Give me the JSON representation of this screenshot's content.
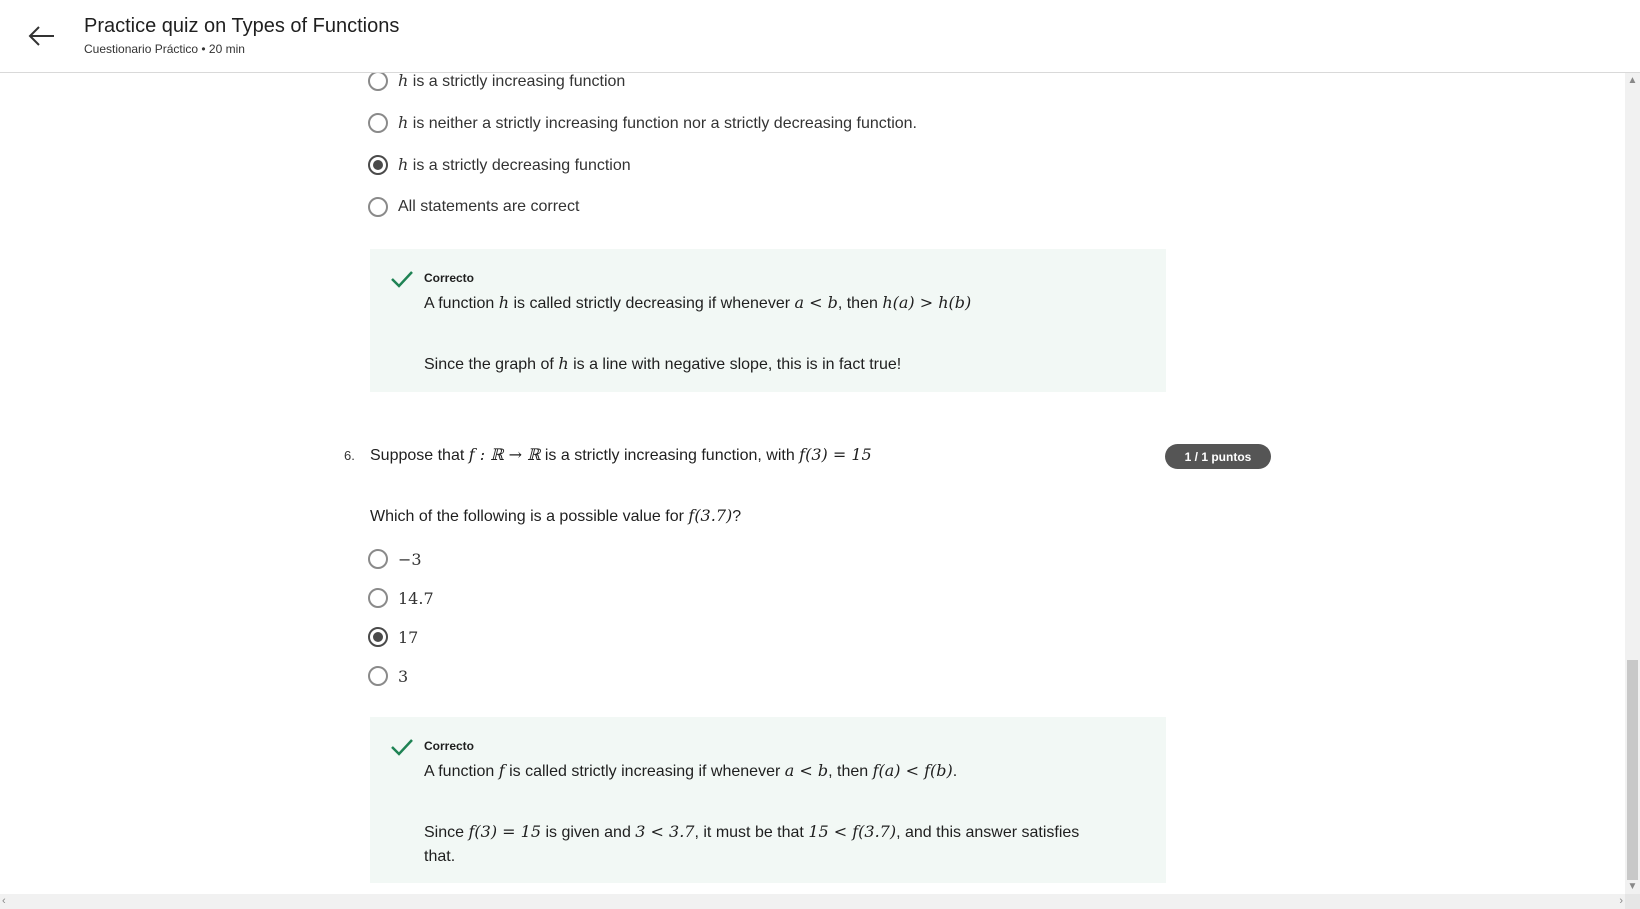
{
  "header": {
    "title": "Practice quiz on Types of Functions",
    "subtitle": "Cuestionario Práctico • 20 min"
  },
  "q5": {
    "options": [
      {
        "var": "h",
        "text": " is a strictly increasing function",
        "selected": false
      },
      {
        "var": "h",
        "text": " is neither a strictly increasing function nor a strictly decreasing function.",
        "selected": false
      },
      {
        "var": "h",
        "text": " is a strictly decreasing function",
        "selected": true
      },
      {
        "var": "",
        "text": "All statements are correct",
        "selected": false
      }
    ],
    "feedback": {
      "status": "Correcto",
      "line1_a": "A function ",
      "line1_var": "h",
      "line1_b": " is called strictly decreasing if whenever ",
      "line1_math1": "a < b",
      "line1_c": ", then ",
      "line1_math2": "h(a) > h(b)",
      "line2_a": "Since the graph of ",
      "line2_var": "h",
      "line2_b": " is a line with negative slope, this is in fact true!"
    }
  },
  "q6": {
    "number": "6.",
    "text_a": "Suppose that ",
    "math_a": "f : ℝ → ℝ",
    "text_b": " is a strictly increasing function, with ",
    "math_b": "f(3) = 15",
    "score": "1 / 1 puntos",
    "prompt_a": "Which of the following is a possible value for ",
    "prompt_math": "f(3.7)",
    "prompt_b": "?",
    "options": [
      {
        "text": "−3",
        "selected": false
      },
      {
        "text": "14.7",
        "selected": false
      },
      {
        "text": "17",
        "selected": true
      },
      {
        "text": "3",
        "selected": false
      }
    ],
    "feedback": {
      "status": "Correcto",
      "line1_a": "A function ",
      "line1_var": "f",
      "line1_b": " is called strictly increasing if whenever ",
      "line1_math1": "a < b",
      "line1_c": ", then ",
      "line1_math2": "f(a) < f(b)",
      "line1_d": ".",
      "line2_a": "Since ",
      "line2_math1": "f(3) = 15",
      "line2_b": " is given and ",
      "line2_math2": "3 < 3.7",
      "line2_c": ", it must be that ",
      "line2_math3": "15 < f(3.7)",
      "line2_d": ", and this answer satisfies",
      "line3": "that."
    }
  },
  "colors": {
    "feedback_bg": "#f2f8f5",
    "check_green": "#1f8354",
    "badge_bg": "#555555"
  }
}
